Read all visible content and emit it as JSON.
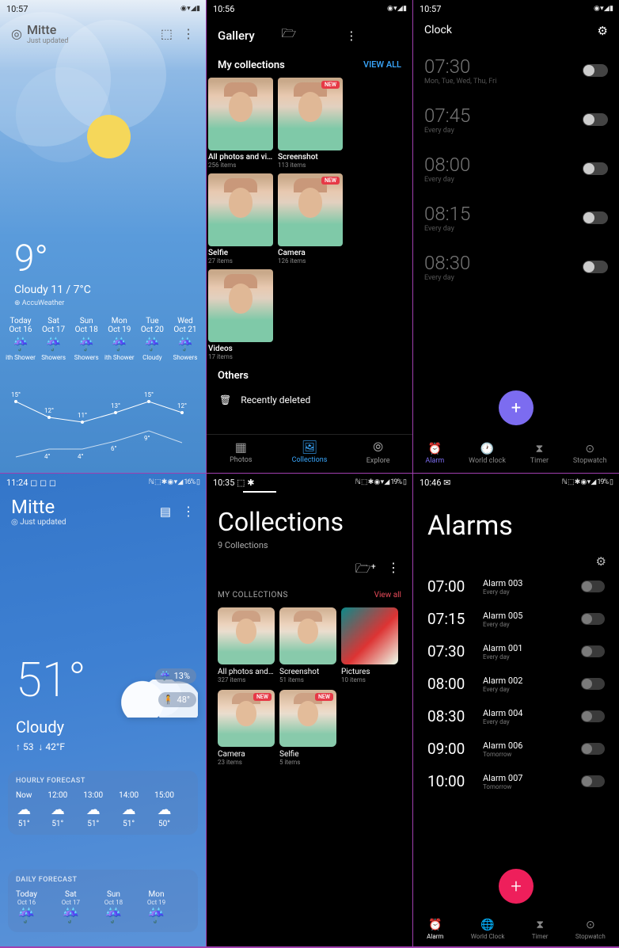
{
  "p1": {
    "time": "10:57",
    "loc": "Mitte",
    "updated": "Just updated",
    "temp": "9°",
    "cond": "Cloudy  11 / 7°C",
    "aw": "⊕ AccuWeather",
    "days": [
      {
        "d": "Today",
        "dt": "Oct 16",
        "c": "ith Shower"
      },
      {
        "d": "Sat",
        "dt": "Oct 17",
        "c": "Showers"
      },
      {
        "d": "Sun",
        "dt": "Oct 18",
        "c": "Showers"
      },
      {
        "d": "Mon",
        "dt": "Oct 19",
        "c": "ith Shower"
      },
      {
        "d": "Tue",
        "dt": "Oct 20",
        "c": "Cloudy"
      },
      {
        "d": "Wed",
        "dt": "Oct 21",
        "c": "Showers"
      }
    ],
    "highs": [
      "15°",
      "12°",
      "11°",
      "13°",
      "15°",
      "12°"
    ],
    "lows": [
      "",
      "4°",
      "4°",
      "6°",
      "9°",
      ""
    ]
  },
  "p2": {
    "time": "10:56",
    "title": "Gallery",
    "sect": "My collections",
    "viewall": "VIEW ALL",
    "colls": [
      {
        "l": "All photos and vid...",
        "c": "256 items",
        "badge": ""
      },
      {
        "l": "Screenshot",
        "c": "113 items",
        "badge": "NEW"
      },
      {
        "l": "Selfie",
        "c": "27 items",
        "badge": ""
      },
      {
        "l": "Camera",
        "c": "126 items",
        "badge": "NEW"
      },
      {
        "l": "Videos",
        "c": "17 items",
        "badge": ""
      }
    ],
    "others": "Others",
    "del": "Recently deleted",
    "nav": [
      "Photos",
      "Collections",
      "Explore"
    ]
  },
  "p3": {
    "time": "10:57",
    "title": "Clock",
    "alarms": [
      {
        "t": "07:30",
        "s": "Mon, Tue, Wed, Thu, Fri"
      },
      {
        "t": "07:45",
        "s": "Every day"
      },
      {
        "t": "08:00",
        "s": "Every day"
      },
      {
        "t": "08:15",
        "s": "Every day"
      },
      {
        "t": "08:30",
        "s": "Every day"
      }
    ],
    "nav": [
      "Alarm",
      "World clock",
      "Timer",
      "Stopwatch"
    ]
  },
  "p4": {
    "time": "11:24",
    "batt": "16%",
    "loc": "Mitte",
    "updated": "◎ Just updated",
    "temp": "51°",
    "cond": "Cloudy",
    "hi": "↑ 53",
    "lo": "↓ 42°F",
    "precip": "13%",
    "feels": "48°",
    "hf": "HOURLY FORECAST",
    "hours": [
      {
        "h": "Now",
        "t": "51°"
      },
      {
        "h": "12:00",
        "t": "51°"
      },
      {
        "h": "13:00",
        "t": "51°"
      },
      {
        "h": "14:00",
        "t": "51°"
      },
      {
        "h": "15:00",
        "t": "50°"
      },
      {
        "h": "",
        "t": ""
      }
    ],
    "df": "DAILY FORECAST",
    "dfdays": [
      {
        "d": "Today",
        "dt": "Oct 16"
      },
      {
        "d": "Sat",
        "dt": "Oct 17"
      },
      {
        "d": "Sun",
        "dt": "Oct 18"
      },
      {
        "d": "Mon",
        "dt": "Oct 19"
      },
      {
        "d": "",
        "dt": ""
      }
    ]
  },
  "p5": {
    "time": "10:35",
    "batt": "19%",
    "title": "Collections",
    "sub": "9 Collections",
    "sect": "MY COLLECTIONS",
    "viewall": "View all",
    "r1": [
      {
        "l": "All photos and vide...",
        "c": "327 items",
        "badge": "",
        "cls": ""
      },
      {
        "l": "Screenshot",
        "c": "51 items",
        "badge": "",
        "cls": ""
      },
      {
        "l": "Pictures",
        "c": "10 items",
        "badge": "",
        "cls": "pic"
      }
    ],
    "r2": [
      {
        "l": "Camera",
        "c": "23 items",
        "badge": "NEW",
        "cls": ""
      },
      {
        "l": "Selfie",
        "c": "5 items",
        "badge": "NEW",
        "cls": ""
      }
    ]
  },
  "p6": {
    "time": "10:46",
    "batt": "19%",
    "title": "Alarms",
    "alarms": [
      {
        "t": "07:00",
        "l": "Alarm 003",
        "s": "Every day"
      },
      {
        "t": "07:15",
        "l": "Alarm 005",
        "s": "Every day"
      },
      {
        "t": "07:30",
        "l": "Alarm 001",
        "s": "Every day"
      },
      {
        "t": "08:00",
        "l": "Alarm 002",
        "s": "Every day"
      },
      {
        "t": "08:30",
        "l": "Alarm 004",
        "s": "Every day"
      },
      {
        "t": "09:00",
        "l": "Alarm 006",
        "s": "Tomorrow"
      },
      {
        "t": "10:00",
        "l": "Alarm 007",
        "s": "Tomorrow"
      }
    ],
    "nav": [
      "Alarm",
      "World Clock",
      "Timer",
      "Stopwatch"
    ]
  }
}
